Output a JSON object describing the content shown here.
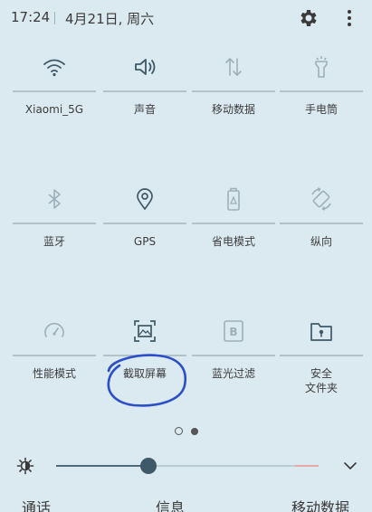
{
  "statusbar": {
    "time": "17:24",
    "date": "4月21日, 周六",
    "settings_icon": "gear-icon",
    "more_icon": "more-vert-icon"
  },
  "tiles": [
    {
      "label": "Xiaomi_5G",
      "icon": "wifi-icon",
      "active": true
    },
    {
      "label": "声音",
      "icon": "volume-icon",
      "active": true
    },
    {
      "label": "移动数据",
      "icon": "mobile-data-icon",
      "active": false
    },
    {
      "label": "手电筒",
      "icon": "flashlight-icon",
      "active": false
    },
    {
      "label": "蓝牙",
      "icon": "bluetooth-icon",
      "active": false
    },
    {
      "label": "GPS",
      "icon": "location-icon",
      "active": true
    },
    {
      "label": "省电模式",
      "icon": "battery-saver-icon",
      "active": false
    },
    {
      "label": "纵向",
      "icon": "rotate-icon",
      "active": false
    },
    {
      "label": "性能模式",
      "icon": "speedometer-icon",
      "active": false
    },
    {
      "label": "截取屏幕",
      "icon": "screenshot-icon",
      "active": true
    },
    {
      "label": "蓝光过滤",
      "icon": "blue-light-filter-icon",
      "active": false
    },
    {
      "label": "安全\n文件夹",
      "icon": "secure-folder-icon",
      "active": true
    }
  ],
  "pager": {
    "pages": 2,
    "current": 2
  },
  "brightness": {
    "level": 0.35,
    "icon": "brightness-icon",
    "expand_icon": "chevron-down-icon"
  },
  "bottom_tabs": [
    "通话",
    "信息",
    "移动数据"
  ],
  "colors": {
    "background": "#dbe9f0",
    "active_icon": "#3f5968",
    "inactive_icon": "#9db0b9",
    "annotation": "#2c4fc7"
  }
}
